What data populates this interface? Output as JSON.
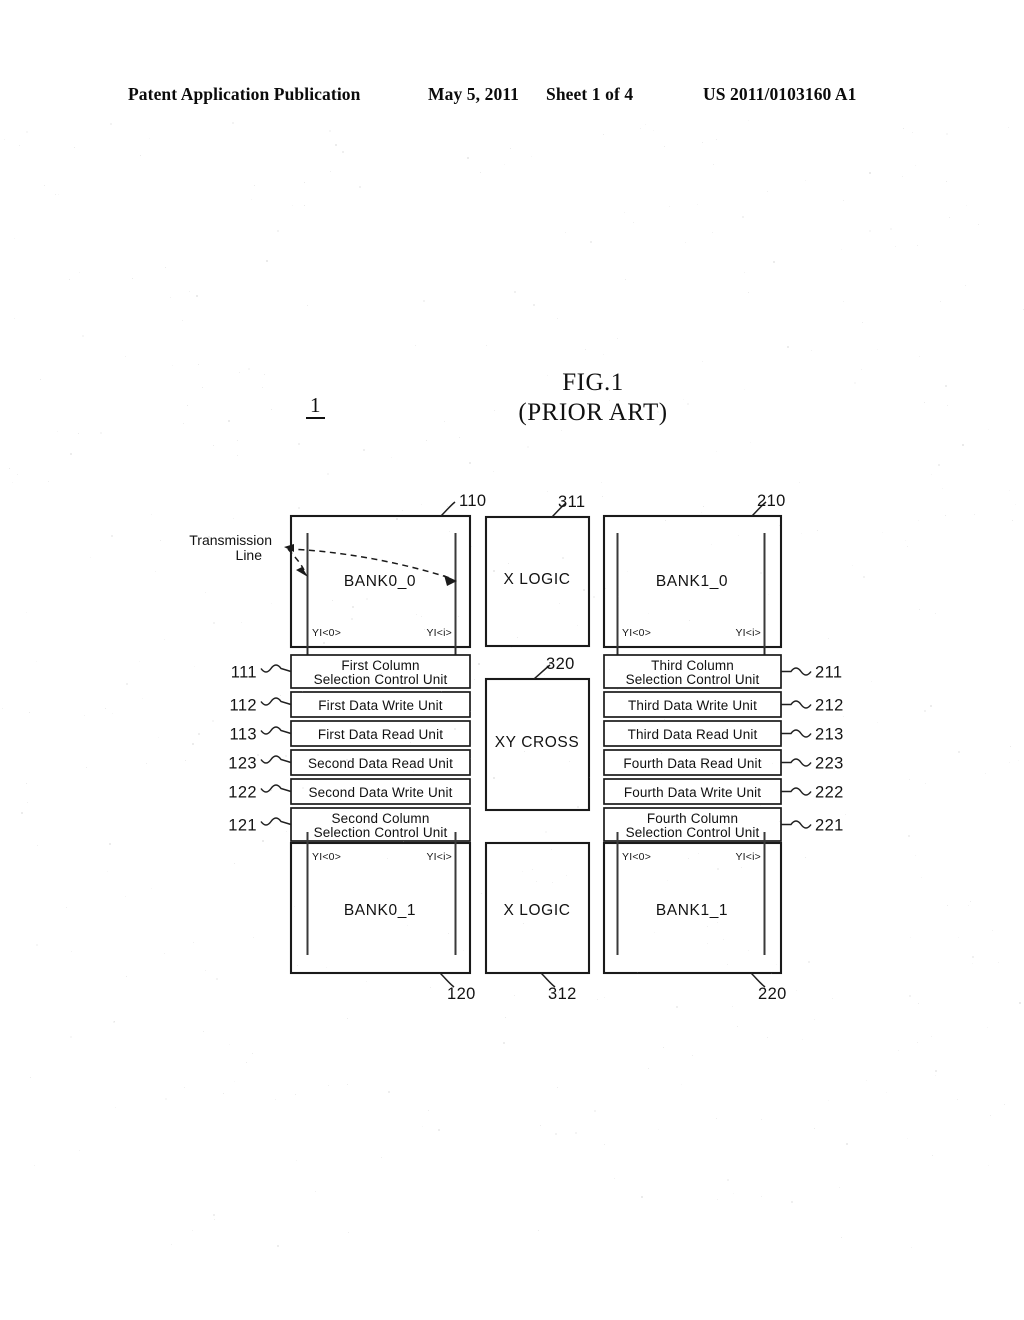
{
  "header": {
    "publication": "Patent Application Publication",
    "date": "May 5, 2011",
    "sheet": "Sheet 1 of 4",
    "patent_number": "US 2011/0103160 A1"
  },
  "figure": {
    "title": "FIG.1",
    "subtitle": "(PRIOR ART)",
    "system_ref": "1"
  },
  "annotations": {
    "transmission_line_l1": "Transmission",
    "transmission_line_l2": "Line"
  },
  "banks": {
    "top_left": {
      "label": "BANK0_0",
      "ref": "110",
      "yi_first": "YI<0>",
      "yi_last": "YI<i>"
    },
    "top_right": {
      "label": "BANK1_0",
      "ref": "210",
      "yi_first": "YI<0>",
      "yi_last": "YI<i>"
    },
    "bottom_left": {
      "label": "BANK0_1",
      "ref": "120",
      "yi_first": "YI<0>",
      "yi_last": "YI<i>"
    },
    "bottom_right": {
      "label": "BANK1_1",
      "ref": "220",
      "yi_first": "YI<0>",
      "yi_last": "YI<i>"
    }
  },
  "logic_blocks": {
    "x_logic_top": {
      "label": "X LOGIC",
      "ref": "311"
    },
    "x_logic_bottom": {
      "label": "X LOGIC",
      "ref": "312"
    },
    "xy_cross": {
      "label": "XY  CROSS",
      "ref": "320"
    }
  },
  "left_units": [
    {
      "line1": "First Column",
      "line2": "Selection Control Unit",
      "ref": "111",
      "two_line": true
    },
    {
      "line1": "First Data Write Unit",
      "line2": "",
      "ref": "112",
      "two_line": false
    },
    {
      "line1": "First Data Read Unit",
      "line2": "",
      "ref": "113",
      "two_line": false
    },
    {
      "line1": "Second Data Read Unit",
      "line2": "",
      "ref": "123",
      "two_line": false
    },
    {
      "line1": "Second Data Write Unit",
      "line2": "",
      "ref": "122",
      "two_line": false
    },
    {
      "line1": "Second Column",
      "line2": "Selection Control Unit",
      "ref": "121",
      "two_line": true
    }
  ],
  "right_units": [
    {
      "line1": "Third Column",
      "line2": "Selection Control Unit",
      "ref": "211",
      "two_line": true
    },
    {
      "line1": "Third Data Write Unit",
      "line2": "",
      "ref": "212",
      "two_line": false
    },
    {
      "line1": "Third Data Read Unit",
      "line2": "",
      "ref": "213",
      "two_line": false
    },
    {
      "line1": "Fourth Data Read Unit",
      "line2": "",
      "ref": "223",
      "two_line": false
    },
    {
      "line1": "Fourth Data Write Unit",
      "line2": "",
      "ref": "222",
      "two_line": false
    },
    {
      "line1": "Fourth Column",
      "line2": "Selection Control Unit",
      "ref": "221",
      "two_line": true
    }
  ],
  "colors": {
    "ink": "#111111",
    "paper": "#ffffff",
    "line": "#1a1a1a"
  }
}
